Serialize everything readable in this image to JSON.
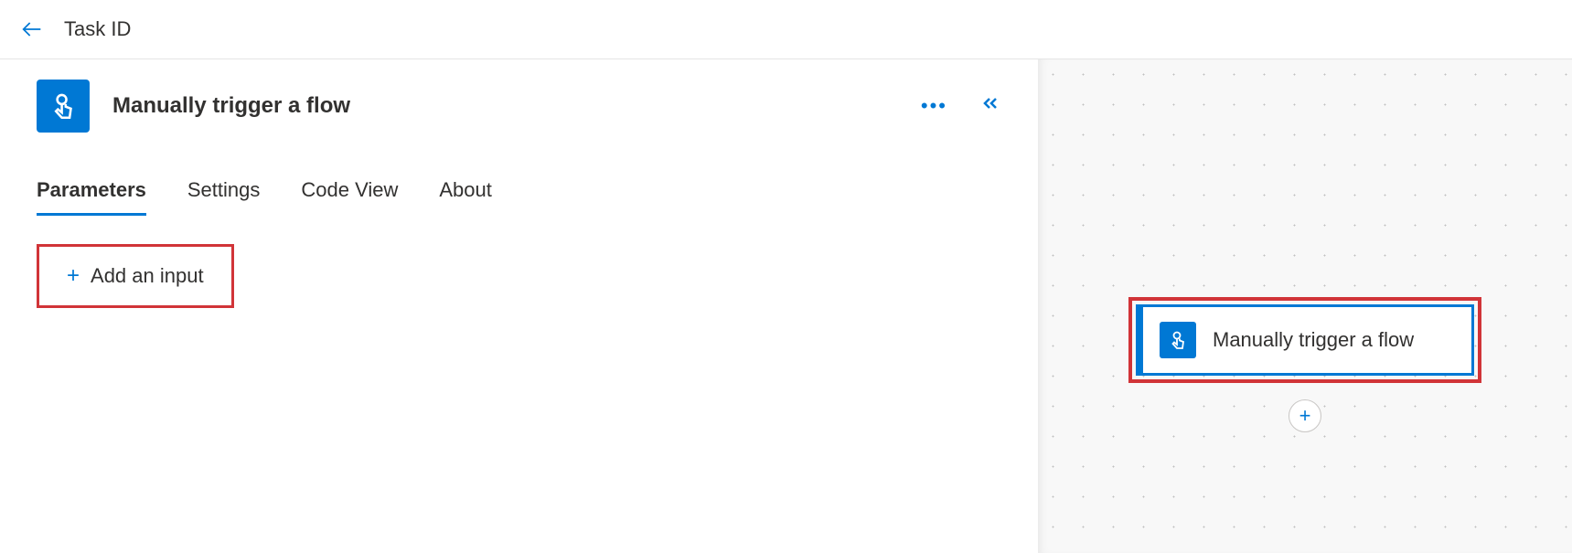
{
  "header": {
    "title": "Task ID"
  },
  "panel": {
    "trigger_title": "Manually trigger a flow",
    "tabs": [
      {
        "label": "Parameters",
        "active": true
      },
      {
        "label": "Settings",
        "active": false
      },
      {
        "label": "Code View",
        "active": false
      },
      {
        "label": "About",
        "active": false
      }
    ],
    "add_input_label": "Add an input"
  },
  "canvas": {
    "node_label": "Manually trigger a flow"
  }
}
